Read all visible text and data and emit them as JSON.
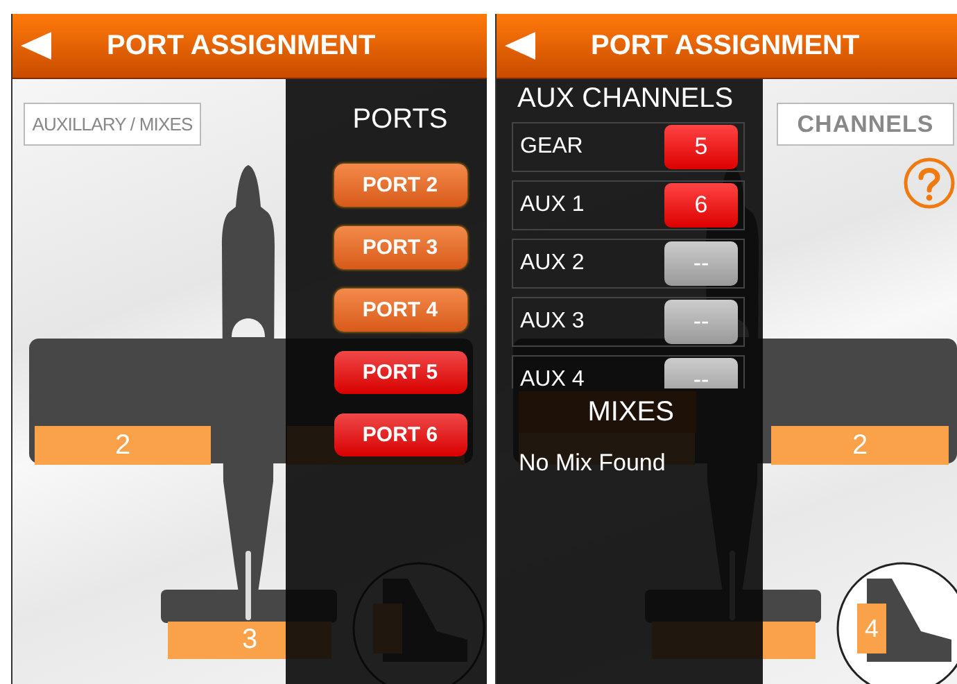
{
  "screens": [
    {
      "title": "PORT ASSIGNMENT",
      "mode_button": "AUXILLARY / MIXES",
      "surfaces": [
        {
          "kind": "left_aileron",
          "label": "2"
        },
        {
          "kind": "elevator",
          "label": "3"
        }
      ],
      "panel": {
        "kind": "ports",
        "heading": "PORTS",
        "ports": [
          {
            "label": "PORT 2",
            "assigned": false
          },
          {
            "label": "PORT 3",
            "assigned": false
          },
          {
            "label": "PORT 4",
            "assigned": false
          },
          {
            "label": "PORT 5",
            "assigned": true
          },
          {
            "label": "PORT 6",
            "assigned": true
          }
        ]
      }
    },
    {
      "title": "PORT ASSIGNMENT",
      "mode_button": "CHANNELS",
      "surfaces": [
        {
          "kind": "right_aileron",
          "label": "2"
        },
        {
          "kind": "rudder",
          "label": "4"
        }
      ],
      "panel": {
        "kind": "aux",
        "heading": "AUX CHANNELS",
        "channels": [
          {
            "name": "GEAR",
            "value": "5",
            "assigned": true
          },
          {
            "name": "AUX 1",
            "value": "6",
            "assigned": true
          },
          {
            "name": "AUX 2",
            "value": "--",
            "assigned": false
          },
          {
            "name": "AUX 3",
            "value": "--",
            "assigned": false
          },
          {
            "name": "AUX 4",
            "value": "--",
            "assigned": false
          }
        ],
        "mixes_heading": "MIXES",
        "mixes_message": "No Mix Found"
      }
    }
  ]
}
